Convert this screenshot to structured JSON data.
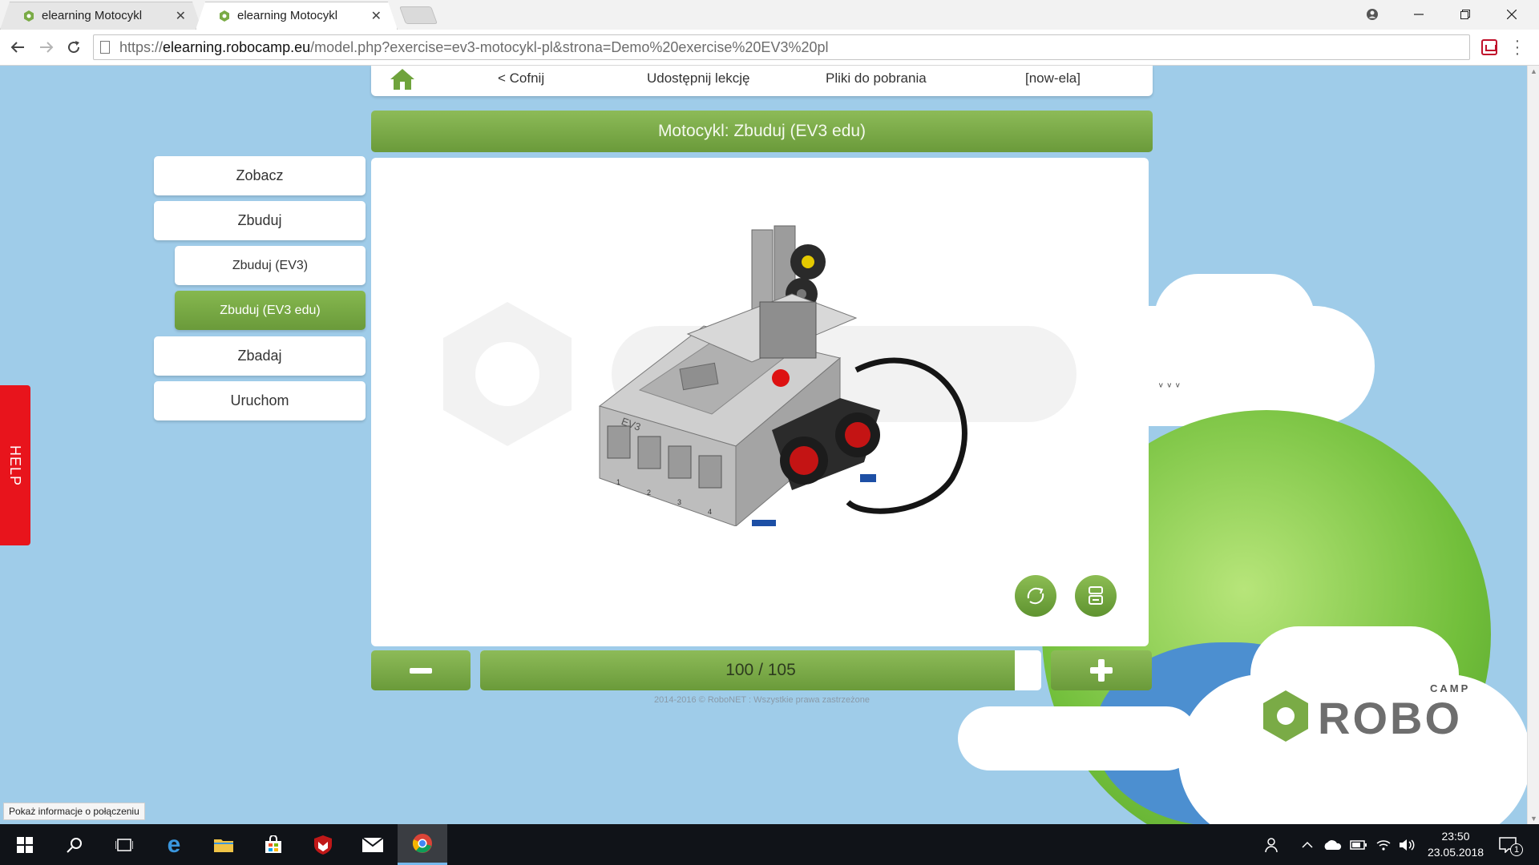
{
  "browser": {
    "tabs": [
      {
        "title": "elearning Motocykl",
        "active": false
      },
      {
        "title": "elearning Motocykl",
        "active": true
      }
    ],
    "url_prefix": "https://",
    "url_domain": "elearning.robocamp.eu",
    "url_path": "/model.php?exercise=ev3-motocykl-pl&strona=Demo%20exercise%20EV3%20pl"
  },
  "topnav": {
    "back": "< Cofnij",
    "share": "Udostępnij lekcję",
    "downloads": "Pliki do pobrania",
    "user": "[now-ela]"
  },
  "title": "Motocykl: Zbuduj (EV3 edu)",
  "sidebar": {
    "items": [
      {
        "label": "Zobacz",
        "level": 0,
        "active": false
      },
      {
        "label": "Zbuduj",
        "level": 0,
        "active": false
      },
      {
        "label": "Zbuduj (EV3)",
        "level": 1,
        "active": false
      },
      {
        "label": "Zbuduj (EV3 edu)",
        "level": 1,
        "active": true
      },
      {
        "label": "Zbadaj",
        "level": 0,
        "active": false
      },
      {
        "label": "Uruchom",
        "level": 0,
        "active": false
      }
    ]
  },
  "help": "HELP",
  "model": {
    "ev3_label": "EV3",
    "port_labels": [
      "1",
      "2",
      "3",
      "4"
    ]
  },
  "step": {
    "current": 100,
    "total": 105,
    "label": "100 / 105"
  },
  "footer": {
    "copyright": "2014-2016 © RoboNET : Wszystkie prawa zastrzeżone"
  },
  "logo": {
    "small": "CAMP",
    "big": "ROBO"
  },
  "status_hint": "Pokaż informacje o połączeniu",
  "taskbar": {
    "time": "23:50",
    "date": "23.05.2018",
    "notifications": "1"
  },
  "colors": {
    "accent_green": "#7aab46",
    "sky": "#9fcce9",
    "help_red": "#e8141c"
  }
}
